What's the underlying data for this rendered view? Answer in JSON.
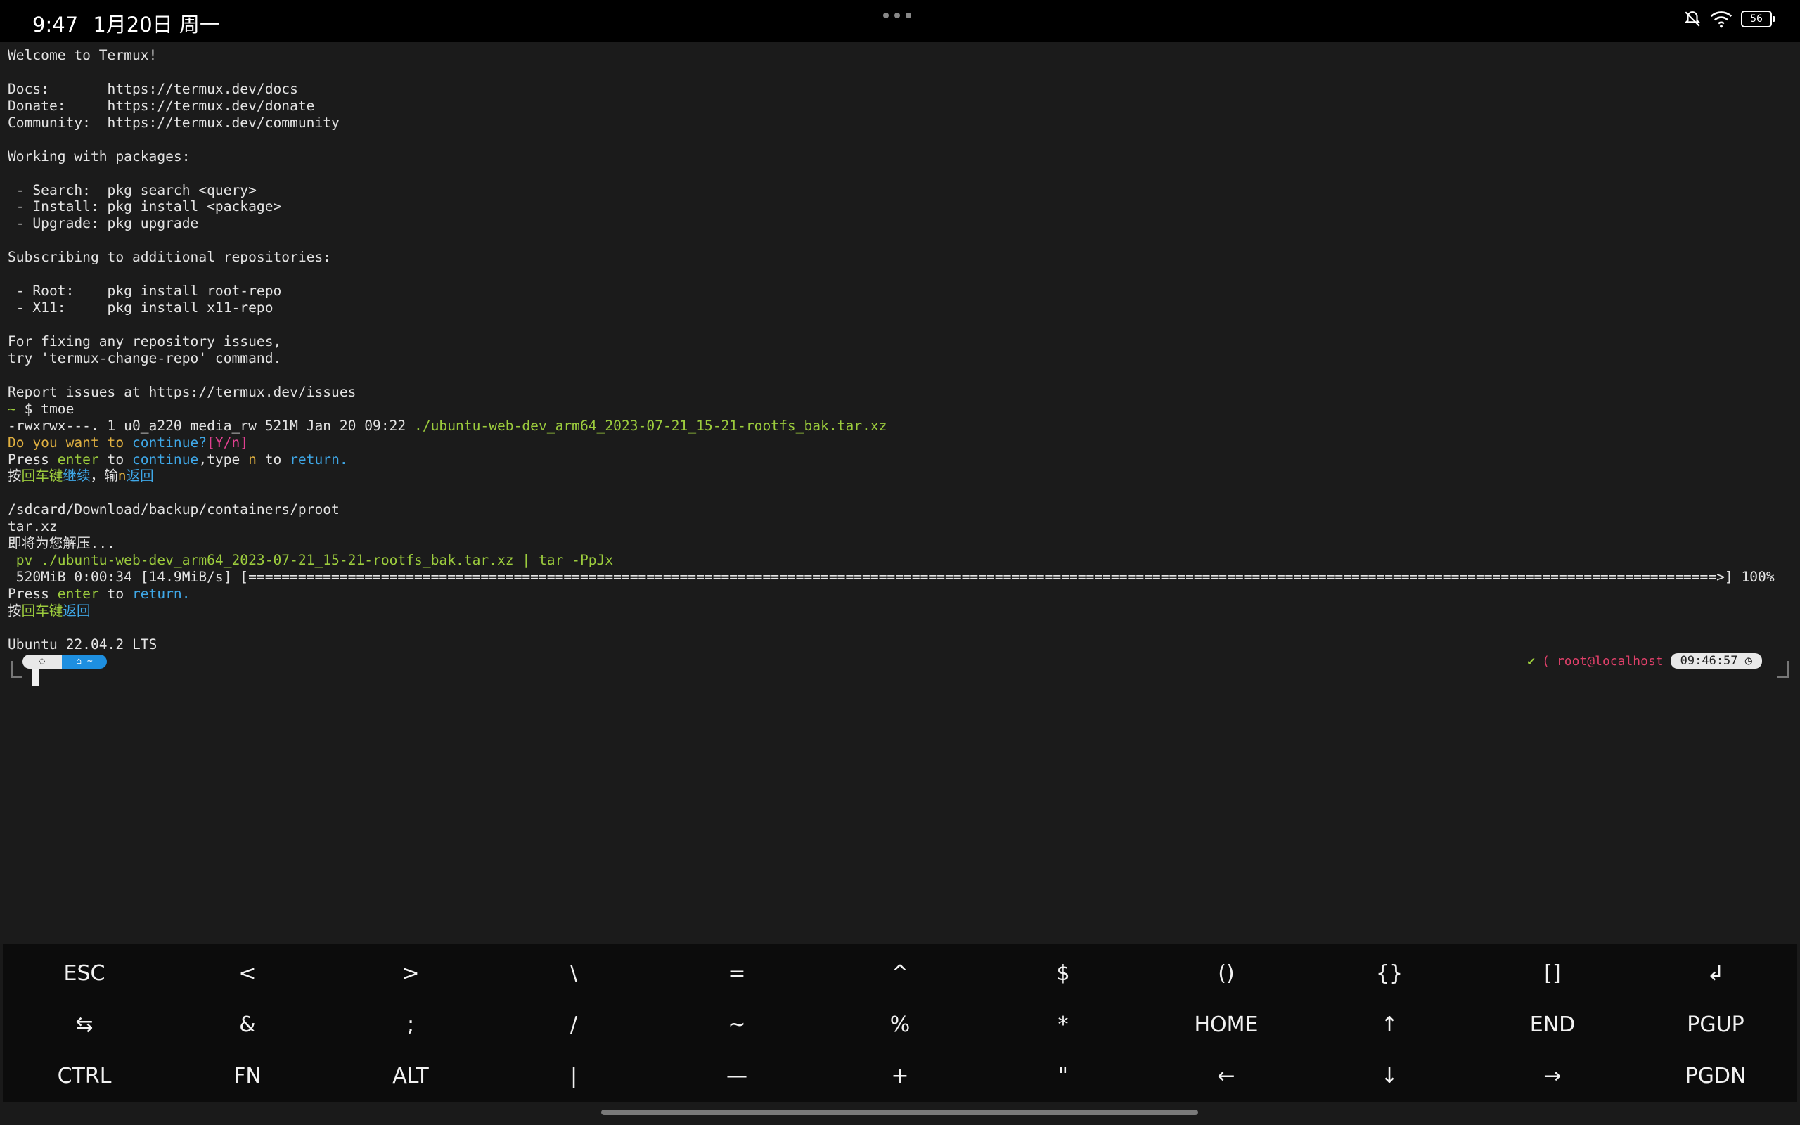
{
  "status_bar": {
    "time": "9:47",
    "date": "1月20日 周一",
    "battery": "56",
    "icons": [
      "bell-off-icon",
      "wifi-icon",
      "battery-icon"
    ]
  },
  "terminal": {
    "lines": [
      [
        {
          "t": "Welcome to Termux!"
        }
      ],
      [
        {
          "t": ""
        }
      ],
      [
        {
          "t": "Docs:       https://termux.dev/docs"
        }
      ],
      [
        {
          "t": "Donate:     https://termux.dev/donate"
        }
      ],
      [
        {
          "t": "Community:  https://termux.dev/community"
        }
      ],
      [
        {
          "t": ""
        }
      ],
      [
        {
          "t": "Working with packages:"
        }
      ],
      [
        {
          "t": ""
        }
      ],
      [
        {
          "t": " - Search:  pkg search <query>"
        }
      ],
      [
        {
          "t": " - Install: pkg install <package>"
        }
      ],
      [
        {
          "t": " - Upgrade: pkg upgrade"
        }
      ],
      [
        {
          "t": ""
        }
      ],
      [
        {
          "t": "Subscribing to additional repositories:"
        }
      ],
      [
        {
          "t": ""
        }
      ],
      [
        {
          "t": " - Root:    pkg install root-repo"
        }
      ],
      [
        {
          "t": " - X11:     pkg install x11-repo"
        }
      ],
      [
        {
          "t": ""
        }
      ],
      [
        {
          "t": "For fixing any repository issues,"
        }
      ],
      [
        {
          "t": "try 'termux-change-repo' command."
        }
      ],
      [
        {
          "t": ""
        }
      ],
      [
        {
          "t": "Report issues at https://termux.dev/issues"
        }
      ],
      [
        {
          "t": "~ ",
          "c": "green"
        },
        {
          "t": "$ tmoe"
        }
      ],
      [
        {
          "t": "-rwxrwx---. 1 u0_a220 media_rw 521M Jan 20 09:22 "
        },
        {
          "t": "./ubuntu-web-dev_arm64_2023-07-21_15-21-rootfs_bak.tar.xz",
          "c": "green"
        }
      ],
      [
        {
          "t": "Do you want to ",
          "c": "orange"
        },
        {
          "t": "continue?",
          "c": "blue"
        },
        {
          "t": "[Y/n]",
          "c": "magenta"
        }
      ],
      [
        {
          "t": "Press "
        },
        {
          "t": "enter",
          "c": "green"
        },
        {
          "t": " to "
        },
        {
          "t": "continue",
          "c": "blue"
        },
        {
          "t": ",type "
        },
        {
          "t": "n",
          "c": "orange"
        },
        {
          "t": " to "
        },
        {
          "t": "return.",
          "c": "blue"
        }
      ],
      [
        {
          "t": "按"
        },
        {
          "t": "回车键",
          "c": "green"
        },
        {
          "t": "继续",
          "c": "blue"
        },
        {
          "t": "，输"
        },
        {
          "t": "n",
          "c": "orange"
        },
        {
          "t": "返回",
          "c": "blue"
        }
      ],
      [
        {
          "t": ""
        }
      ],
      [
        {
          "t": "/sdcard/Download/backup/containers/proot"
        }
      ],
      [
        {
          "t": "tar.xz"
        }
      ],
      [
        {
          "t": "即将为您解压..."
        }
      ],
      [
        {
          "t": " pv ./ubuntu-web-dev_arm64_2023-07-21_15-21-rootfs_bak.tar.xz | tar -PpJx",
          "c": "green"
        }
      ],
      [
        {
          "t": " 520MiB 0:00:34 [14.9MiB/s] [=================================================================================================================================================================================>] 100%"
        }
      ],
      [
        {
          "t": "Press "
        },
        {
          "t": "enter",
          "c": "green"
        },
        {
          "t": " to "
        },
        {
          "t": "return.",
          "c": "blue"
        }
      ],
      [
        {
          "t": "按"
        },
        {
          "t": "回车键",
          "c": "green"
        },
        {
          "t": "返回",
          "c": "blue"
        }
      ],
      [
        {
          "t": ""
        }
      ],
      [
        {
          "t": "Ubuntu 22.04.2 LTS"
        }
      ]
    ],
    "prompt": {
      "check": "✔",
      "paren": "(",
      "host": "root@localhost",
      "clock": "09:46:57 ◷",
      "dir": "⌂ ~",
      "os": "◌"
    }
  },
  "extra_keys": {
    "rows": [
      [
        "ESC",
        "<",
        ">",
        "\\",
        "=",
        "^",
        "$",
        "()",
        "{}",
        "[]",
        "↲"
      ],
      [
        "⇆",
        "&",
        ";",
        "/",
        "~",
        "%",
        "*",
        "HOME",
        "↑",
        "END",
        "PGUP"
      ],
      [
        "CTRL",
        "FN",
        "ALT",
        "|",
        "—",
        "+",
        "\"",
        "←",
        "↓",
        "→",
        "PGDN"
      ]
    ]
  }
}
